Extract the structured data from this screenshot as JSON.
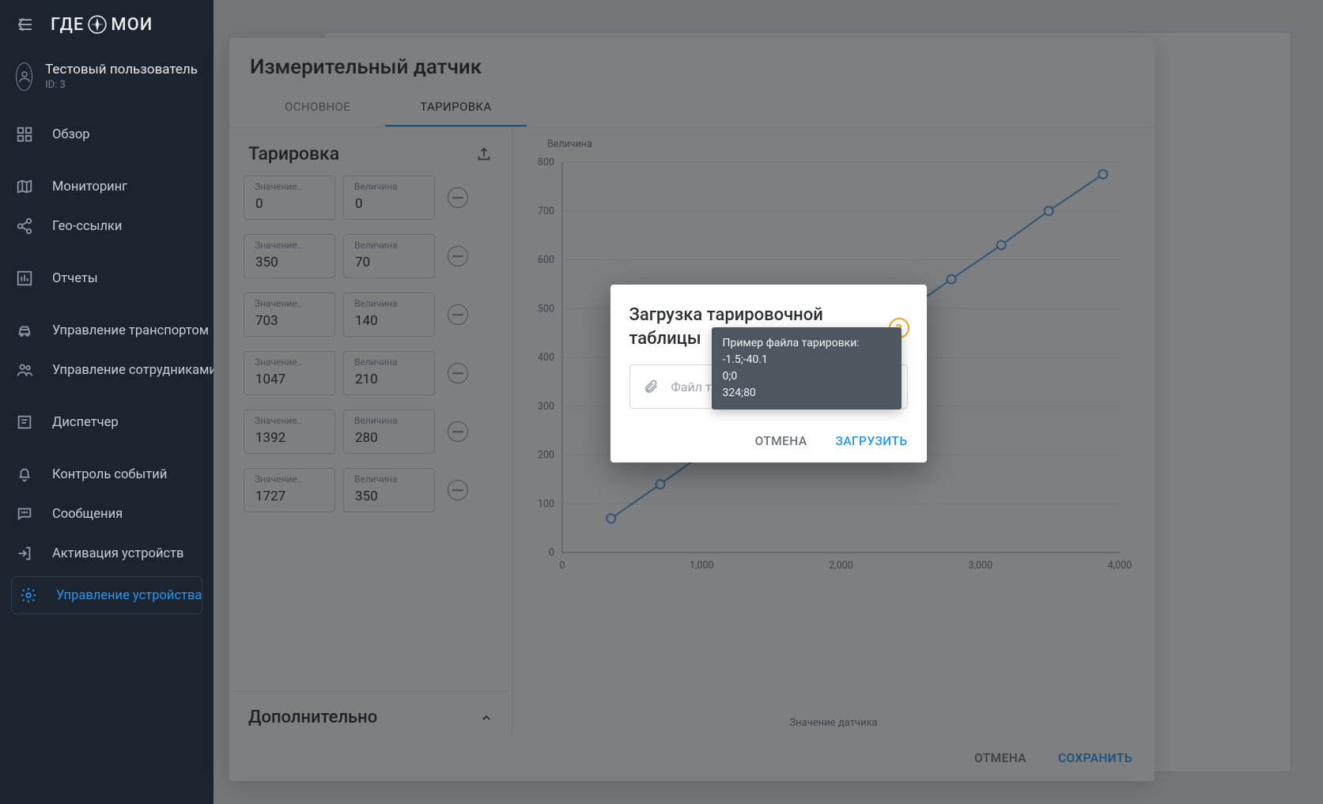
{
  "brand": {
    "part1": "ГДЕ",
    "part2": "МОИ"
  },
  "user": {
    "name": "Тестовый пользователь",
    "id_label": "ID: 3"
  },
  "nav": {
    "overview": "Обзор",
    "monitoring": "Мониторинг",
    "geolinks": "Гео-ссылки",
    "reports": "Отчеты",
    "transport": "Управление транспортом",
    "employees": "Управление сотрудниками",
    "dispatcher": "Диспетчер",
    "events": "Контроль событий",
    "messages": "Сообщения",
    "activation": "Активация устройств",
    "devices": "Управление устройствами"
  },
  "sensor": {
    "title": "Измерительный датчик",
    "tab_main": "ОСНОВНОЕ",
    "tab_cal": "ТАРИРОВКА",
    "section_title": "Тарировка",
    "col_value": "Значение",
    "col_magn": "Величина",
    "addl_title": "Дополнительно",
    "pairs": [
      {
        "value": "0",
        "magnitude": "0"
      },
      {
        "value": "350",
        "magnitude": "70"
      },
      {
        "value": "703",
        "magnitude": "140"
      },
      {
        "value": "1047",
        "magnitude": "210"
      },
      {
        "value": "1392",
        "magnitude": "280"
      },
      {
        "value": "1727",
        "magnitude": "350"
      }
    ],
    "cancel": "ОТМЕНА",
    "save": "СОХРАНИТЬ"
  },
  "upload_dialog": {
    "title": "Загрузка тарировочной таблицы",
    "file_placeholder": "Файл тарировки (CSV)",
    "cancel": "ОТМЕНА",
    "upload": "ЗАГРУЗИТЬ",
    "tooltip_head": "Пример файла тарировки:",
    "tooltip_l1": "-1.5;-40.1",
    "tooltip_l2": "0;0",
    "tooltip_l3": "324;80"
  },
  "chart_data": {
    "type": "line",
    "x": [
      350,
      703,
      1047,
      1392,
      1727,
      2100,
      2440,
      2792,
      3150,
      3490,
      3880
    ],
    "y": [
      70,
      140,
      210,
      280,
      350,
      420,
      490,
      560,
      630,
      700,
      775
    ],
    "xlabel": "Значение датчика",
    "ylabel": "Величина",
    "xlim": [
      0,
      4000
    ],
    "ylim": [
      0,
      800
    ],
    "xticks": [
      0,
      1000,
      2000,
      3000,
      4000
    ],
    "yticks": [
      0,
      100,
      200,
      300,
      400,
      500,
      600,
      700,
      800
    ]
  }
}
